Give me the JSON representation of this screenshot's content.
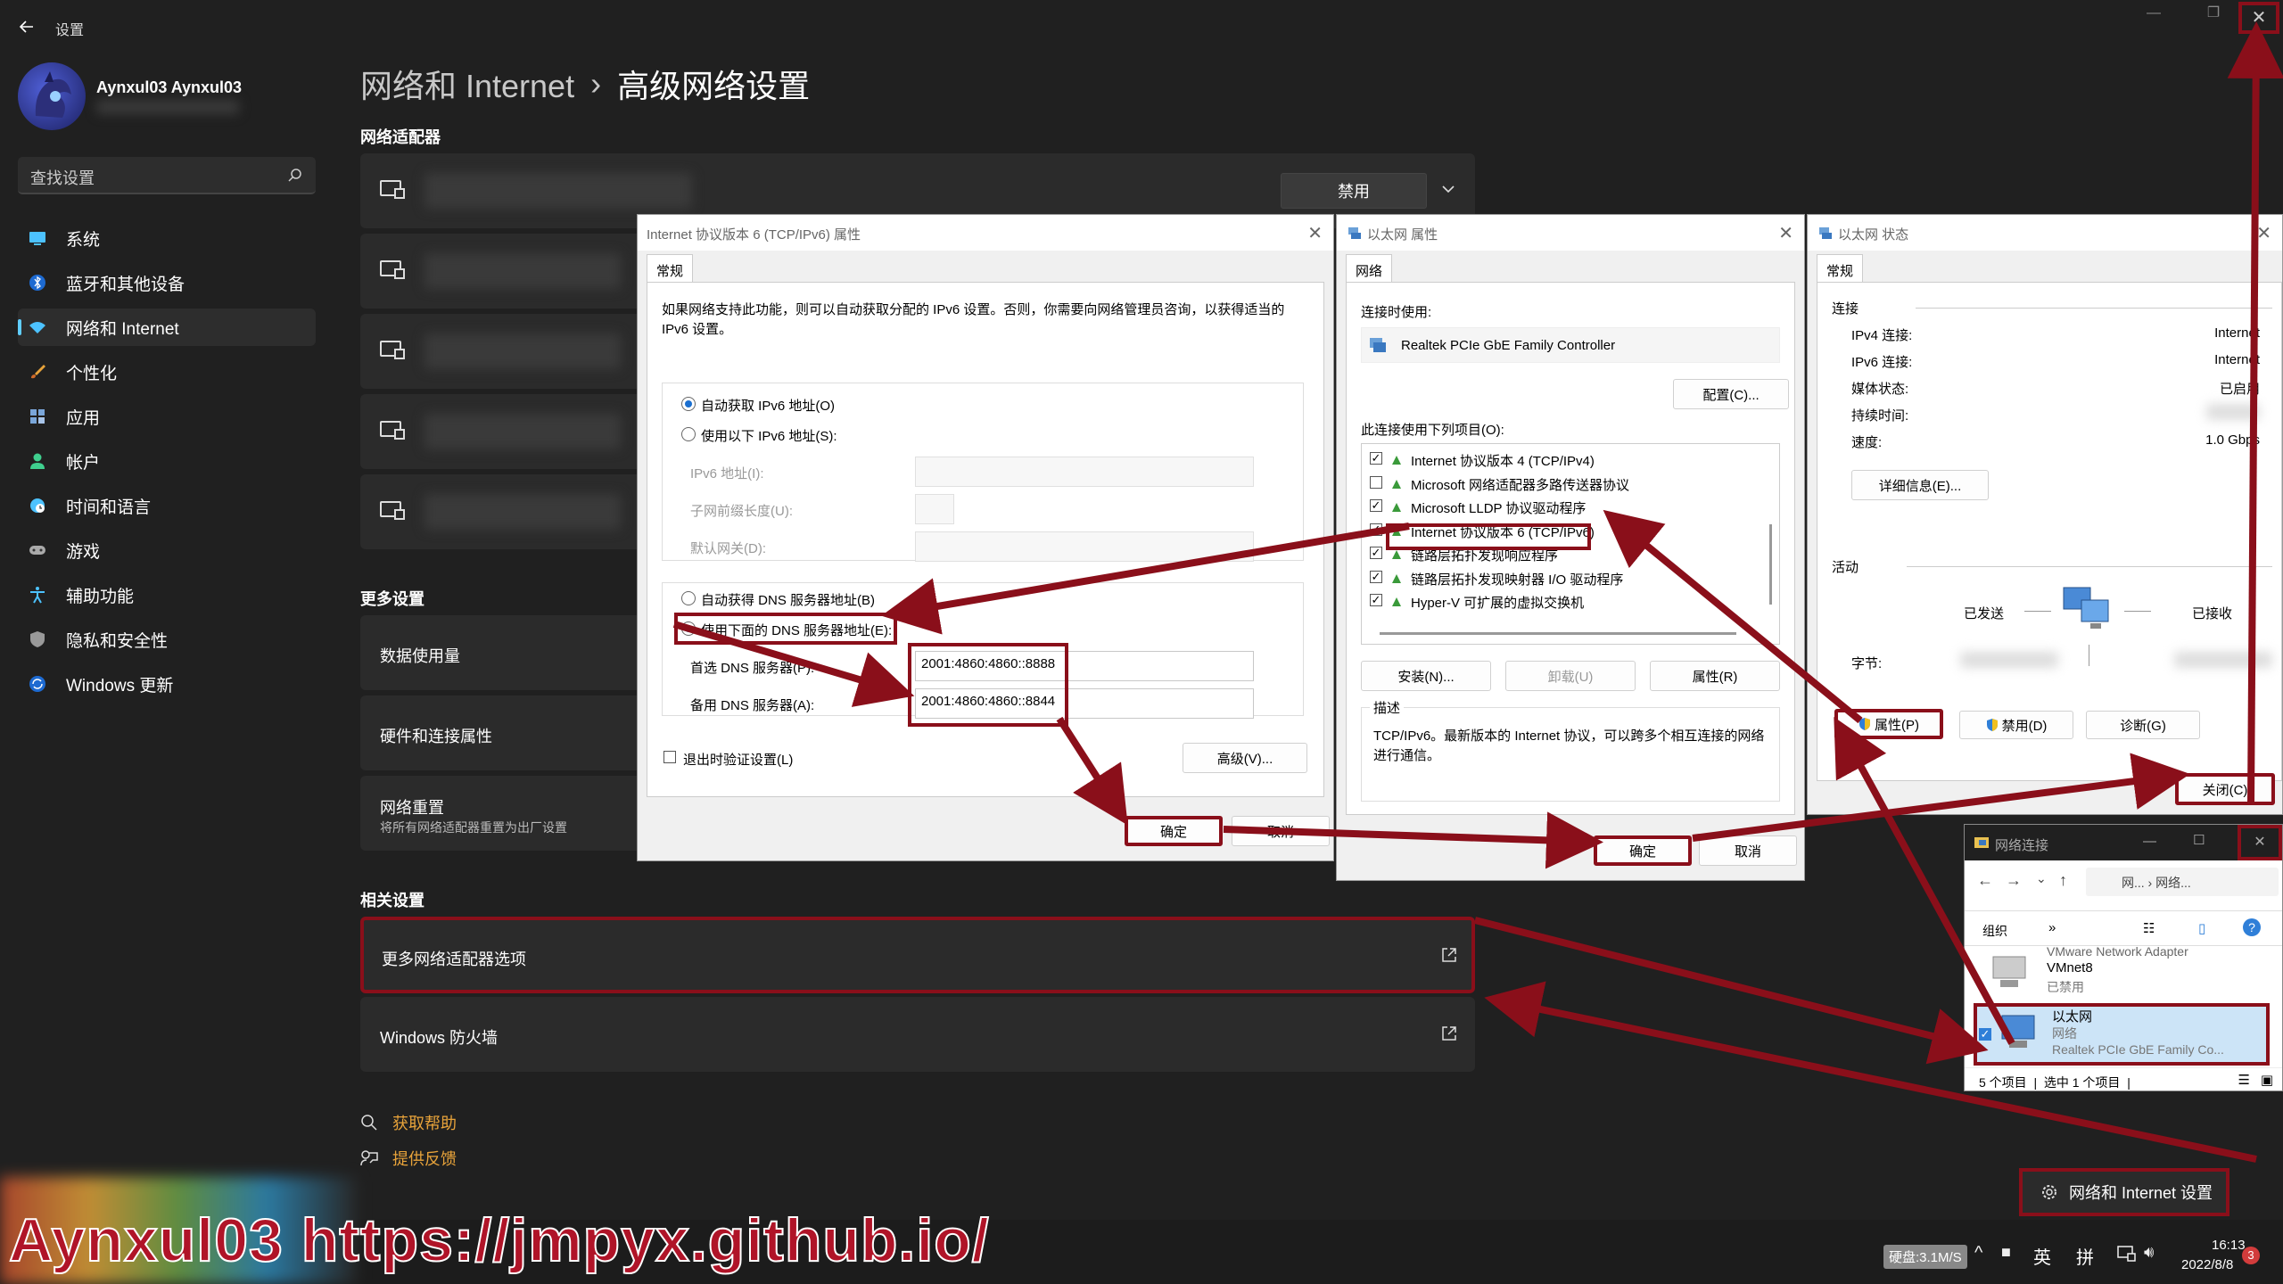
{
  "window": {
    "back_icon": "back-arrow-icon",
    "title": "设置"
  },
  "profile": {
    "name": "Aynxul03 Aynxul03"
  },
  "search": {
    "placeholder": "查找设置",
    "icon": "search-icon"
  },
  "sidebar": {
    "items": [
      {
        "label": "系统",
        "icon": "system-icon",
        "color": "#4cc2ff"
      },
      {
        "label": "蓝牙和其他设备",
        "icon": "bluetooth-icon",
        "color": "#4cc2ff"
      },
      {
        "label": "网络和 Internet",
        "icon": "wifi-icon",
        "color": "#4cc2ff",
        "selected": true
      },
      {
        "label": "个性化",
        "icon": "brush-icon",
        "color": "#e8a33a"
      },
      {
        "label": "应用",
        "icon": "apps-icon",
        "color": "#7aa6d9"
      },
      {
        "label": "帐户",
        "icon": "account-icon",
        "color": "#3fcf8e"
      },
      {
        "label": "时间和语言",
        "icon": "globe-icon",
        "color": "#4cc2ff"
      },
      {
        "label": "游戏",
        "icon": "gamepad-icon",
        "color": "#aaaaaa"
      },
      {
        "label": "辅助功能",
        "icon": "accessibility-icon",
        "color": "#4cc2ff"
      },
      {
        "label": "隐私和安全性",
        "icon": "shield-icon",
        "color": "#aaaaaa"
      },
      {
        "label": "Windows 更新",
        "icon": "update-icon",
        "color": "#4cc2ff"
      }
    ]
  },
  "breadcrumb": {
    "parent": "网络和 Internet",
    "separator": "›",
    "current": "高级网络设置"
  },
  "adapters": {
    "heading": "网络适配器",
    "disable_label": "禁用"
  },
  "more_settings": {
    "heading": "更多设置",
    "items": [
      {
        "label": "数据使用量"
      },
      {
        "label": "硬件和连接属性"
      },
      {
        "label": "网络重置",
        "desc": "将所有网络适配器重置为出厂设置"
      }
    ]
  },
  "related": {
    "heading": "相关设置",
    "items": [
      {
        "label": "更多网络适配器选项"
      },
      {
        "label": "Windows 防火墙"
      }
    ]
  },
  "help": {
    "get_help": "获取帮助",
    "feedback": "提供反馈"
  },
  "ipv6_dialog": {
    "title": "Internet 协议版本 6 (TCP/IPv6) 属性",
    "tab": "常规",
    "intro": "如果网络支持此功能，则可以自动获取分配的 IPv6 设置。否则，你需要向网络管理员咨询，以获得适当的 IPv6 设置。",
    "auto_ip": "自动获取 IPv6 地址(O)",
    "manual_ip": "使用以下 IPv6 地址(S):",
    "ipv6_addr": "IPv6 地址(I):",
    "prefix": "子网前缀长度(U):",
    "gateway": "默认网关(D):",
    "auto_dns": "自动获得 DNS 服务器地址(B)",
    "manual_dns": "使用下面的 DNS 服务器地址(E):",
    "preferred_dns_label": "首选 DNS 服务器(P):",
    "alternate_dns_label": "备用 DNS 服务器(A):",
    "preferred_dns": "2001:4860:4860::8888",
    "alternate_dns": "2001:4860:4860::8844",
    "validate": "退出时验证设置(L)",
    "advanced": "高级(V)...",
    "ok": "确定",
    "cancel": "取消"
  },
  "ethernet_props": {
    "title": "以太网 属性",
    "tab": "网络",
    "connect_using": "连接时使用:",
    "adapter": "Realtek PCIe GbE Family Controller",
    "configure": "配置(C)...",
    "items_label": "此连接使用下列项目(O):",
    "items": [
      {
        "label": "Internet 协议版本 4 (TCP/IPv4)",
        "checked": true
      },
      {
        "label": "Microsoft 网络适配器多路传送器协议",
        "checked": false
      },
      {
        "label": "Microsoft LLDP 协议驱动程序",
        "checked": true
      },
      {
        "label": "Internet 协议版本 6 (TCP/IPv6)",
        "checked": true
      },
      {
        "label": "链路层拓扑发现响应程序",
        "checked": true
      },
      {
        "label": "链路层拓扑发现映射器 I/O 驱动程序",
        "checked": true
      },
      {
        "label": "Hyper-V 可扩展的虚拟交换机",
        "checked": true
      }
    ],
    "install": "安装(N)...",
    "uninstall": "卸载(U)",
    "properties": "属性(R)",
    "desc_heading": "描述",
    "desc": "TCP/IPv6。最新版本的 Internet 协议，可以跨多个相互连接的网络进行通信。",
    "ok": "确定",
    "cancel": "取消"
  },
  "ethernet_status": {
    "title": "以太网 状态",
    "tab": "常规",
    "connection": "连接",
    "rows": [
      {
        "label": "IPv4 连接:",
        "value": "Internet"
      },
      {
        "label": "IPv6 连接:",
        "value": "Internet"
      },
      {
        "label": "媒体状态:",
        "value": "已启用"
      },
      {
        "label": "持续时间:",
        "value": ""
      },
      {
        "label": "速度:",
        "value": "1.0 Gbps"
      }
    ],
    "details": "详细信息(E)...",
    "activity": "活动",
    "sent": "已发送",
    "received": "已接收",
    "bytes": "字节:",
    "properties": "属性(P)",
    "disable": "禁用(D)",
    "diagnose": "诊断(G)",
    "close": "关闭(C)"
  },
  "net_connections": {
    "title": "网络连接",
    "path": "网... › 网络...",
    "organize": "组织",
    "more": "»",
    "items": [
      {
        "name": "VMnet8",
        "status": "已禁用",
        "top": "VMware Network Adapter"
      },
      {
        "name": "以太网",
        "status": "网络",
        "device": "Realtek PCIe GbE Family Co..."
      }
    ],
    "statusbar": "5 个项目  |  选中 1 个项目  |"
  },
  "taskbar": {
    "popup": "网络和 Internet 设置",
    "disk": "硬盘:3.1M/S",
    "ime1": "英",
    "ime2": "拼",
    "time": "16:13",
    "date": "2022/8/8",
    "badge": "3"
  },
  "watermark": "Aynxul03 https://jmpyx.github.io/"
}
